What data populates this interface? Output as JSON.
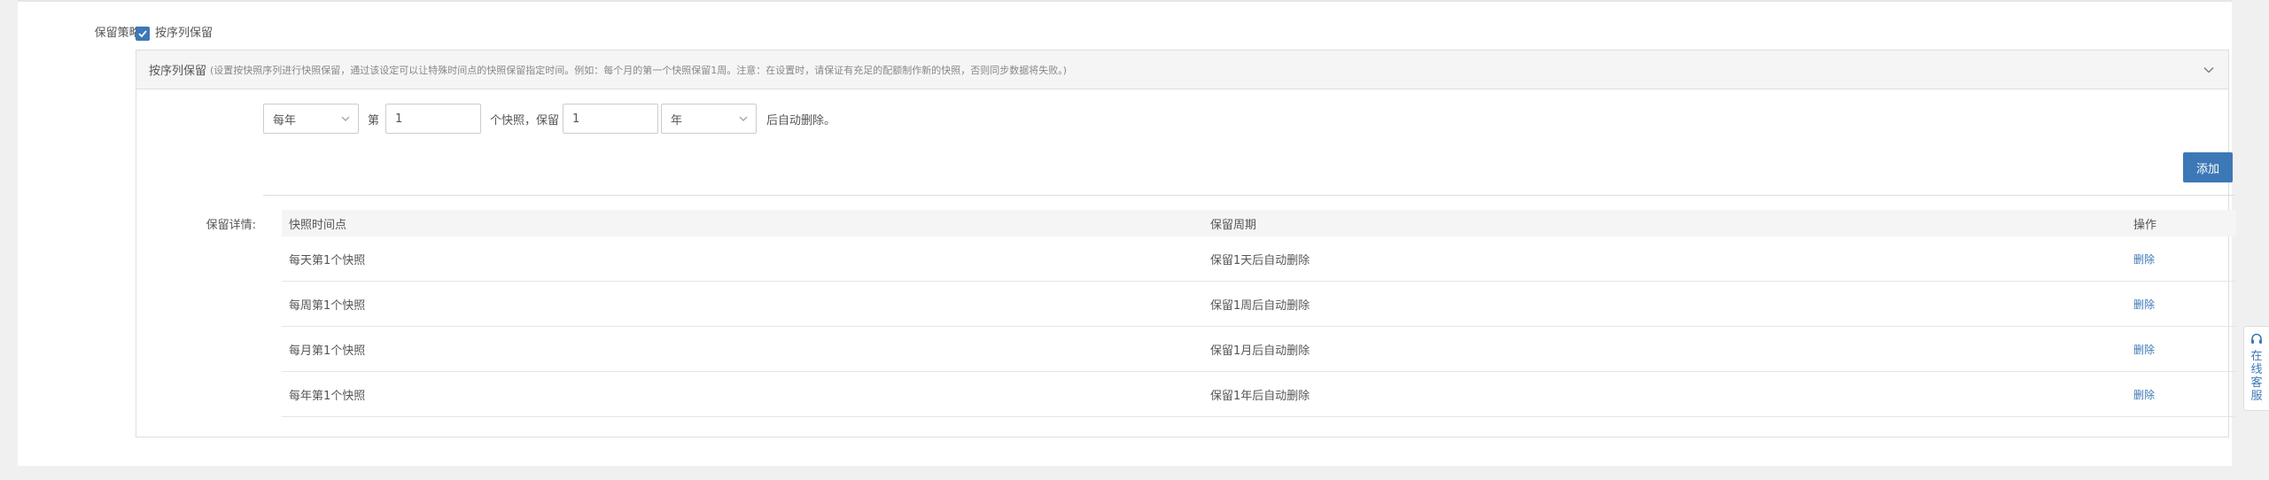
{
  "policy": {
    "label": "保留策略:",
    "checkbox_label": "按序列保留",
    "checked": true
  },
  "panel": {
    "title": "按序列保留",
    "description": "(设置按快照序列进行快照保留，通过该设定可以让特殊时间点的快照保留指定时间。例如：每个月的第一个快照保留1周。注意：在设置时，请保证有充足的配额制作新的快照，否则同步数据将失败。)"
  },
  "rule": {
    "period_select": "每年",
    "ordinal_prefix": "第",
    "ordinal_value": "1",
    "snapshot_text": "个快照，保留",
    "keep_value": "1",
    "unit_select": "年",
    "suffix_text": "后自动删除。"
  },
  "add_button": "添加",
  "details": {
    "label": "保留详情:",
    "columns": [
      "快照时间点",
      "保留周期",
      "操作"
    ],
    "rows": [
      {
        "point": "每天第1个快照",
        "period": "保留1天后自动删除",
        "action": "删除"
      },
      {
        "point": "每周第1个快照",
        "period": "保留1周后自动删除",
        "action": "删除"
      },
      {
        "point": "每月第1个快照",
        "period": "保留1月后自动删除",
        "action": "删除"
      },
      {
        "point": "每年第1个快照",
        "period": "保留1年后自动删除",
        "action": "删除"
      }
    ]
  },
  "service": {
    "text": "在线客服",
    "icon": "headset-icon"
  },
  "colors": {
    "accent": "#3d78b6"
  }
}
